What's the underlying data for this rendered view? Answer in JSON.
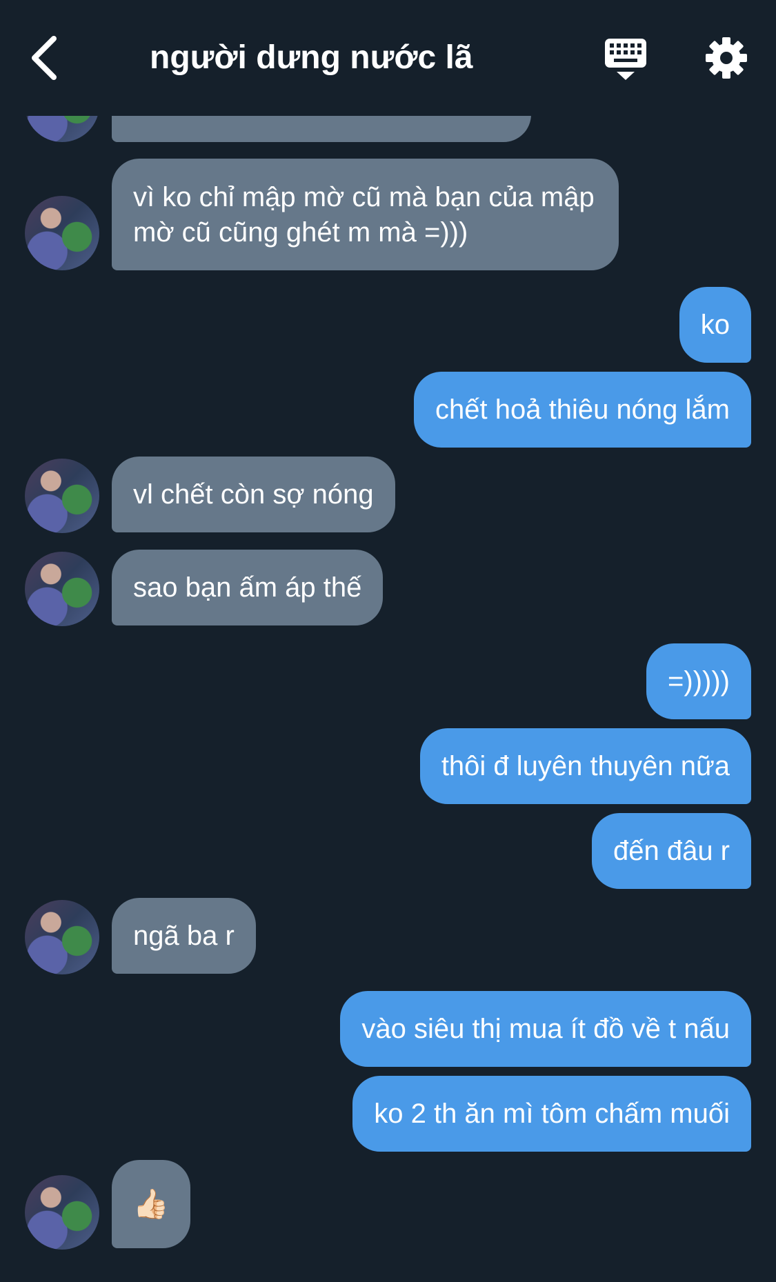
{
  "header": {
    "title": "người dưng nước lã"
  },
  "messages": [
    {
      "from": "other",
      "text": ""
    },
    {
      "from": "other",
      "text": "vì ko chỉ mập mờ cũ mà bạn của mập mờ cũ cũng ghét m mà =)))"
    },
    {
      "from": "me",
      "text": "ko"
    },
    {
      "from": "me",
      "text": "chết hoả thiêu nóng lắm"
    },
    {
      "from": "other",
      "text": "vl chết còn sợ nóng"
    },
    {
      "from": "other",
      "text": "sao bạn ấm áp thế"
    },
    {
      "from": "me",
      "text": "=)))))"
    },
    {
      "from": "me",
      "text": "thôi đ luyên thuyên nữa"
    },
    {
      "from": "me",
      "text": "đến đâu r"
    },
    {
      "from": "other",
      "text": "ngã ba r"
    },
    {
      "from": "me",
      "text": "vào siêu thị mua ít đồ về t nấu"
    },
    {
      "from": "me",
      "text": "ko 2 th ăn mì tôm chấm muối"
    },
    {
      "from": "other",
      "text": "👍🏻"
    }
  ],
  "colors": {
    "background": "#15202b",
    "received_bubble": "#66788a",
    "sent_bubble": "#4a9ae8",
    "text": "#ffffff"
  },
  "icons": {
    "back": "chevron-left-icon",
    "keyboard": "keyboard-icon",
    "settings": "gear-icon"
  }
}
